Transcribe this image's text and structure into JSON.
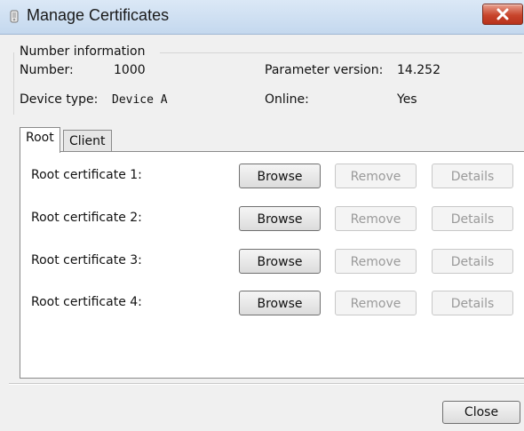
{
  "window": {
    "title": "Manage Certificates",
    "icon": "certificate-icon"
  },
  "number_info": {
    "legend": "Number information",
    "number_label": "Number:",
    "number_value": "1000",
    "param_version_label": "Parameter version:",
    "param_version_value": "14.252",
    "device_type_label": "Device type:",
    "device_type_value": "Device A",
    "online_label": "Online:",
    "online_value": "Yes"
  },
  "tabs": [
    {
      "label": "Root",
      "active": true
    },
    {
      "label": "Client",
      "active": false
    }
  ],
  "certificates": [
    {
      "label": "Root certificate 1:",
      "browse": "Browse",
      "remove": "Remove",
      "details": "Details"
    },
    {
      "label": "Root certificate 2:",
      "browse": "Browse",
      "remove": "Remove",
      "details": "Details"
    },
    {
      "label": "Root certificate 3:",
      "browse": "Browse",
      "remove": "Remove",
      "details": "Details"
    },
    {
      "label": "Root certificate 4:",
      "browse": "Browse",
      "remove": "Remove",
      "details": "Details"
    }
  ],
  "footer": {
    "close_label": "Close"
  },
  "colors": {
    "titlebar": "#c4d8ee",
    "close_button": "#c8452c",
    "panel": "#ffffff",
    "client": "#f0f0f0"
  }
}
